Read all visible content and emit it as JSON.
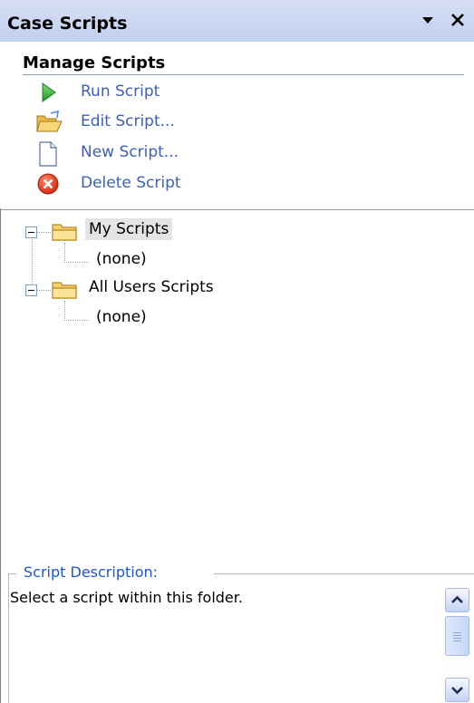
{
  "pane": {
    "title": "Case Scripts",
    "menu_icon": "dropdown-arrow-icon",
    "close_icon": "close-icon"
  },
  "manage": {
    "heading": "Manage Scripts",
    "tasks": [
      {
        "label": "Run Script",
        "icon": "play-icon"
      },
      {
        "label": "Edit Script...",
        "icon": "open-folder-icon"
      },
      {
        "label": "New Script...",
        "icon": "new-document-icon"
      },
      {
        "label": "Delete Script",
        "icon": "delete-icon"
      }
    ]
  },
  "tree": {
    "folders": [
      {
        "label": "My Scripts",
        "selected": true,
        "children": [
          "(none)"
        ]
      },
      {
        "label": "All Users Scripts",
        "selected": false,
        "children": [
          "(none)"
        ]
      }
    ]
  },
  "description": {
    "legend": "Script Description:",
    "text": "Select a script within this folder."
  },
  "colors": {
    "task_link": "#3c5fbd",
    "legend": "#1f55d8",
    "titlebar": "#c9d5f1",
    "selection": "#e4e4e4"
  }
}
